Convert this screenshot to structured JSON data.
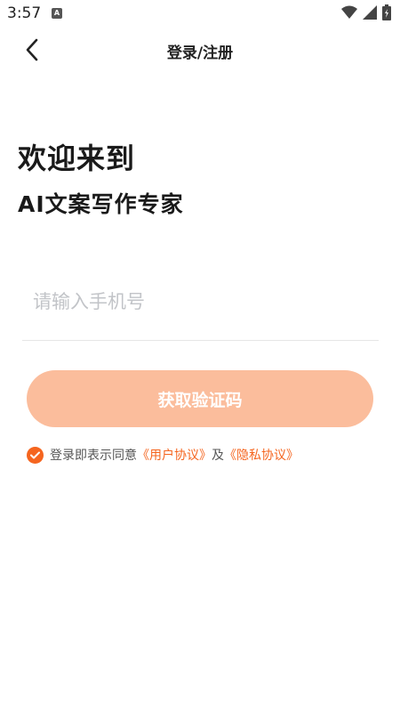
{
  "status_bar": {
    "time": "3:57",
    "notification_icon": "a-letter-icon",
    "icons": [
      "wifi-icon",
      "signal-icon",
      "battery-icon"
    ]
  },
  "header": {
    "title": "登录/注册",
    "back_icon": "chevron-left-icon"
  },
  "welcome": {
    "title": "欢迎来到",
    "subtitle": "AI文案写作专家"
  },
  "phone": {
    "value": "",
    "placeholder": "请输入手机号"
  },
  "get_code_button": {
    "label": "获取验证码"
  },
  "agreement": {
    "checked": true,
    "text": "登录即表示同意",
    "user_agreement": "《用户协议》",
    "conjunction": "及",
    "privacy_policy": "《隐私协议》"
  },
  "colors": {
    "accent": "#f5651f",
    "button_disabled": "#fbbd9c",
    "placeholder": "#c2c4c8"
  }
}
